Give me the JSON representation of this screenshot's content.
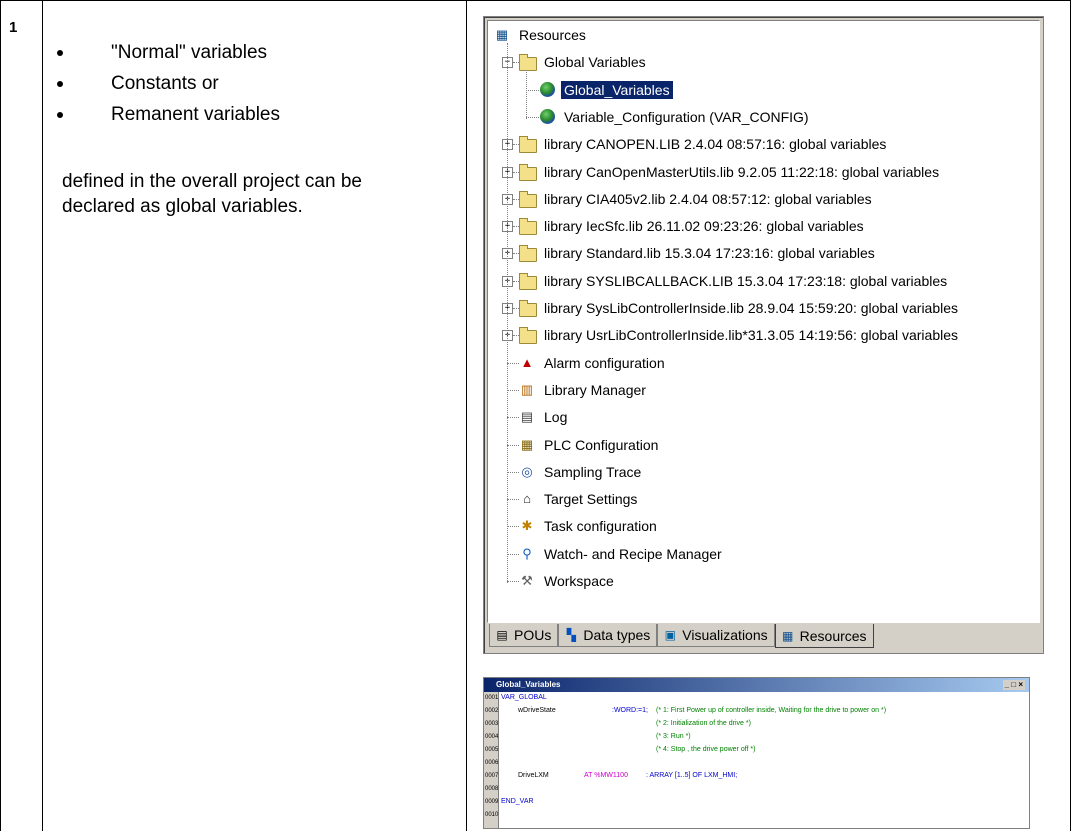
{
  "row_number": "1",
  "bullets": [
    "\"Normal\" variables",
    "Constants or",
    "Remanent variables"
  ],
  "paragraph": "defined in the overall project can be declared as global variables.",
  "tree": {
    "root": "Resources",
    "items": [
      {
        "label": "Global Variables",
        "icon": "folder-open-icon"
      },
      {
        "label": "Global_Variables",
        "icon": "globe-icon",
        "selected": true
      },
      {
        "label": "Variable_Configuration (VAR_CONFIG)",
        "icon": "globe-icon"
      },
      {
        "label": "library CANOPEN.LIB 2.4.04 08:57:16: global variables",
        "icon": "folder-icon"
      },
      {
        "label": "library CanOpenMasterUtils.lib 9.2.05 11:22:18: global variables",
        "icon": "folder-icon"
      },
      {
        "label": "library CIA405v2.lib 2.4.04 08:57:12: global variables",
        "icon": "folder-icon"
      },
      {
        "label": "library IecSfc.lib 26.11.02 09:23:26: global variables",
        "icon": "folder-icon"
      },
      {
        "label": "library Standard.lib 15.3.04 17:23:16: global variables",
        "icon": "folder-icon"
      },
      {
        "label": "library SYSLIBCALLBACK.LIB 15.3.04 17:23:18: global variables",
        "icon": "folder-icon"
      },
      {
        "label": "library SysLibControllerInside.lib 28.9.04 15:59:20: global variables",
        "icon": "folder-icon"
      },
      {
        "label": "library UsrLibControllerInside.lib*31.3.05 14:19:56: global variables",
        "icon": "folder-icon"
      },
      {
        "label": "Alarm configuration",
        "icon": "alarm-icon"
      },
      {
        "label": "Library Manager",
        "icon": "library-icon"
      },
      {
        "label": "Log",
        "icon": "log-icon"
      },
      {
        "label": "PLC Configuration",
        "icon": "plc-icon"
      },
      {
        "label": "Sampling Trace",
        "icon": "trace-icon"
      },
      {
        "label": "Target Settings",
        "icon": "target-icon"
      },
      {
        "label": "Task configuration",
        "icon": "task-icon"
      },
      {
        "label": "Watch- and Recipe Manager",
        "icon": "magnifier-icon"
      },
      {
        "label": "Workspace",
        "icon": "tools-icon"
      }
    ]
  },
  "tabs": [
    {
      "label": "POUs",
      "icon": "pou-icon"
    },
    {
      "label": "Data types",
      "icon": "datatype-icon"
    },
    {
      "label": "Visualizations",
      "icon": "visualization-icon"
    },
    {
      "label": "Resources",
      "icon": "resources-icon",
      "active": true
    }
  ],
  "editor": {
    "title": "Global_Variables",
    "controls": "_ □ ×",
    "lines": [
      {
        "num": "0001",
        "text": "VAR_GLOBAL"
      },
      {
        "num": "0002",
        "name": "wDriveState",
        "type": ":WORD:=1;",
        "comment": "(* 1: First Power up of controller inside, Waiting for the drive to power on  *)"
      },
      {
        "num": "0003",
        "comment": "(* 2: Initialization of the drive                              *)"
      },
      {
        "num": "0004",
        "comment": "(* 3: Run                                                       *)"
      },
      {
        "num": "0005",
        "comment": "(* 4: Stop     , the drive power off                   *)"
      },
      {
        "num": "0006"
      },
      {
        "num": "0007",
        "name": "DriveLXM",
        "at": "AT %MW1100",
        "type": ": ARRAY [1..5] OF LXM_HMI;"
      },
      {
        "num": "0008"
      },
      {
        "num": "0009",
        "text": "END_VAR"
      },
      {
        "num": "0010"
      }
    ]
  }
}
